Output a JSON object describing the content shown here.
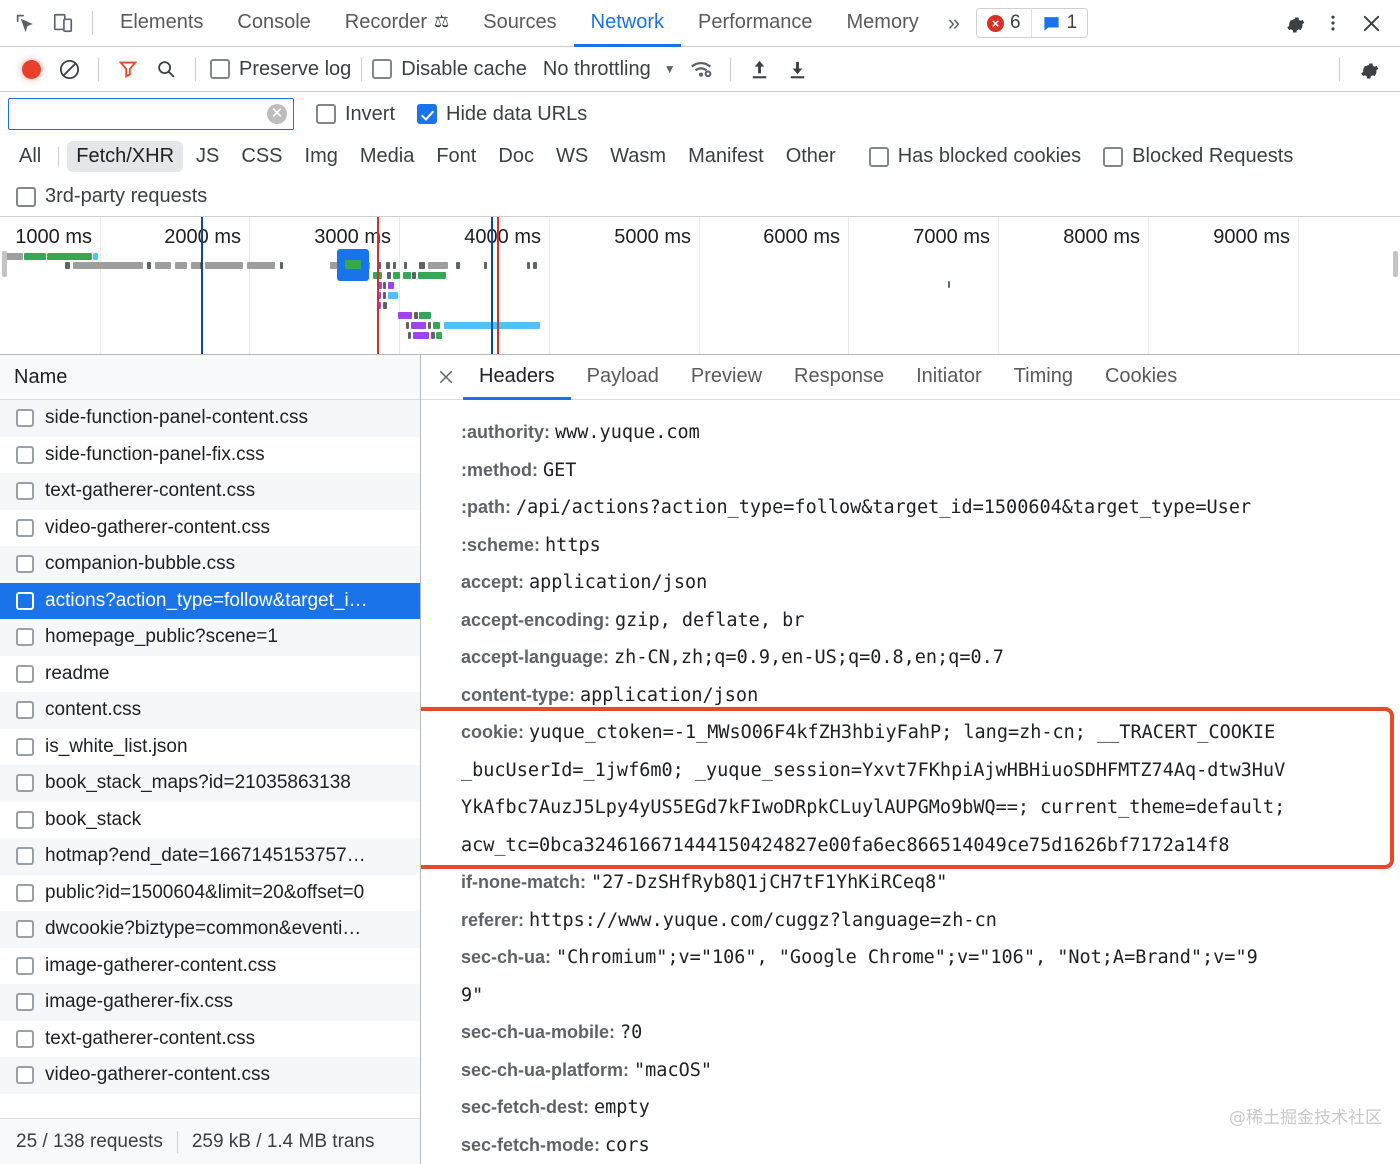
{
  "devtools": {
    "tabs": [
      {
        "label": "Elements",
        "active": false
      },
      {
        "label": "Console",
        "active": false
      },
      {
        "label": "Recorder",
        "active": false,
        "badge": "flask"
      },
      {
        "label": "Sources",
        "active": false
      },
      {
        "label": "Network",
        "active": true
      },
      {
        "label": "Performance",
        "active": false
      },
      {
        "label": "Memory",
        "active": false
      }
    ],
    "more_tabs_icon": "chevron-double-right-icon",
    "inspect_icon": "inspect-element-icon",
    "device_icon": "toggle-device-toolbar-icon",
    "error_count": "6",
    "message_count": "1",
    "settings_icon": "gear-icon",
    "menu_icon": "kebab-menu-icon",
    "close_icon": "close-icon"
  },
  "network_toolbar": {
    "record_icon": "record-button-icon",
    "clear_icon": "clear-network-log-icon",
    "filter_icon": "filter-funnel-icon",
    "search_icon": "search-icon",
    "preserve_log_label": "Preserve log",
    "preserve_log_checked": false,
    "disable_cache_label": "Disable cache",
    "disable_cache_checked": false,
    "throttle_value": "No throttling",
    "throttle_caret_icon": "chevron-down-icon",
    "wifi_icon": "network-conditions-wifi-icon",
    "import_icon": "import-har-icon",
    "export_icon": "export-har-icon",
    "settings_icon": "network-settings-gear-icon"
  },
  "filter": {
    "value": "",
    "placeholder": "",
    "clear_icon": "clear-filter-icon",
    "invert_label": "Invert",
    "invert_checked": false,
    "hide_data_urls_label": "Hide data URLs",
    "hide_data_urls_checked": true,
    "types": [
      {
        "label": "All",
        "selected": false
      },
      {
        "label": "Fetch/XHR",
        "selected": true
      },
      {
        "label": "JS",
        "selected": false
      },
      {
        "label": "CSS",
        "selected": false
      },
      {
        "label": "Img",
        "selected": false
      },
      {
        "label": "Media",
        "selected": false
      },
      {
        "label": "Font",
        "selected": false
      },
      {
        "label": "Doc",
        "selected": false
      },
      {
        "label": "WS",
        "selected": false
      },
      {
        "label": "Wasm",
        "selected": false
      },
      {
        "label": "Manifest",
        "selected": false
      },
      {
        "label": "Other",
        "selected": false
      }
    ],
    "has_blocked_cookies_label": "Has blocked cookies",
    "has_blocked_cookies_checked": false,
    "blocked_requests_label": "Blocked Requests",
    "blocked_requests_checked": false,
    "third_party_label": "3rd-party requests",
    "third_party_checked": false
  },
  "overview": {
    "ticks": [
      "1000 ms",
      "2000 ms",
      "3000 ms",
      "4000 ms",
      "5000 ms",
      "6000 ms",
      "7000 ms",
      "8000 ms",
      "9000 ms"
    ],
    "accent_selected": "#1a73e8",
    "event_line_dcl": "#0d47a1",
    "event_line_load": "#d32f2f"
  },
  "requests": {
    "column_header": "Name",
    "rows": [
      {
        "name": "side-function-panel-content.css",
        "selected": false
      },
      {
        "name": "side-function-panel-fix.css",
        "selected": false
      },
      {
        "name": "text-gatherer-content.css",
        "selected": false
      },
      {
        "name": "video-gatherer-content.css",
        "selected": false
      },
      {
        "name": "companion-bubble.css",
        "selected": false
      },
      {
        "name": "actions?action_type=follow&target_i…",
        "selected": true
      },
      {
        "name": "homepage_public?scene=1",
        "selected": false
      },
      {
        "name": "readme",
        "selected": false
      },
      {
        "name": "content.css",
        "selected": false
      },
      {
        "name": "is_white_list.json",
        "selected": false
      },
      {
        "name": "book_stack_maps?id=21035863138",
        "selected": false
      },
      {
        "name": "book_stack",
        "selected": false
      },
      {
        "name": "hotmap?end_date=1667145153757…",
        "selected": false
      },
      {
        "name": "public?id=1500604&limit=20&offset=0",
        "selected": false
      },
      {
        "name": "dwcookie?biztype=common&eventi…",
        "selected": false
      },
      {
        "name": "image-gatherer-content.css",
        "selected": false
      },
      {
        "name": "image-gatherer-fix.css",
        "selected": false
      },
      {
        "name": "text-gatherer-content.css",
        "selected": false
      },
      {
        "name": "video-gatherer-content.css",
        "selected": false
      }
    ],
    "status_requests": "25 / 138 requests",
    "status_transferred": "259 kB / 1.4 MB trans"
  },
  "detail": {
    "close_icon": "close-panel-icon",
    "tabs": [
      {
        "label": "Headers",
        "active": true
      },
      {
        "label": "Payload",
        "active": false
      },
      {
        "label": "Preview",
        "active": false
      },
      {
        "label": "Response",
        "active": false
      },
      {
        "label": "Initiator",
        "active": false
      },
      {
        "label": "Timing",
        "active": false
      },
      {
        "label": "Cookies",
        "active": false
      }
    ],
    "headers": [
      {
        "key": ":authority:",
        "value": "www.yuque.com"
      },
      {
        "key": ":method:",
        "value": "GET"
      },
      {
        "key": ":path:",
        "value": "/api/actions?action_type=follow&target_id=1500604&target_type=User"
      },
      {
        "key": ":scheme:",
        "value": "https"
      },
      {
        "key": "accept:",
        "value": "application/json"
      },
      {
        "key": "accept-encoding:",
        "value": "gzip, deflate, br"
      },
      {
        "key": "accept-language:",
        "value": "zh-CN,zh;q=0.9,en-US;q=0.8,en;q=0.7"
      },
      {
        "key": "content-type:",
        "value": "application/json"
      }
    ],
    "cookie_header": {
      "key": "cookie:",
      "lines": [
        "yuque_ctoken=-1_MWsO06F4kfZH3hbiyFahP; lang=zh-cn; __TRACERT_COOKIE",
        "_bucUserId=_1jwf6m0; _yuque_session=Yxvt7FKhpiAjwHBHiuoSDHFMTZ74Aq-dtw3HuV",
        "YkAfbc7AuzJ5Lpy4yUS5EGd7kFIwoDRpkCLuylAUPGMo9bWQ==; current_theme=default;",
        "acw_tc=0bca324616671444150424827e00fa6ec866514049ce75d1626bf7172a14f8"
      ],
      "highlight_color": "#e8492b"
    },
    "headers_after": [
      {
        "key": "if-none-match:",
        "value": "\"27-DzSHfRyb8Q1jCH7tF1YhKiRCeq8\""
      },
      {
        "key": "referer:",
        "value": "https://www.yuque.com/cuggz?language=zh-cn"
      },
      {
        "key": "sec-ch-ua:",
        "value": "\"Chromium\";v=\"106\", \"Google Chrome\";v=\"106\", \"Not;A=Brand\";v=\"9"
      },
      {
        "key": "",
        "value": "9\""
      },
      {
        "key": "sec-ch-ua-mobile:",
        "value": "?0"
      },
      {
        "key": "sec-ch-ua-platform:",
        "value": "\"macOS\""
      },
      {
        "key": "sec-fetch-dest:",
        "value": "empty"
      },
      {
        "key": "sec-fetch-mode:",
        "value": "cors"
      }
    ],
    "watermark": "@稀土掘金技术社区"
  }
}
